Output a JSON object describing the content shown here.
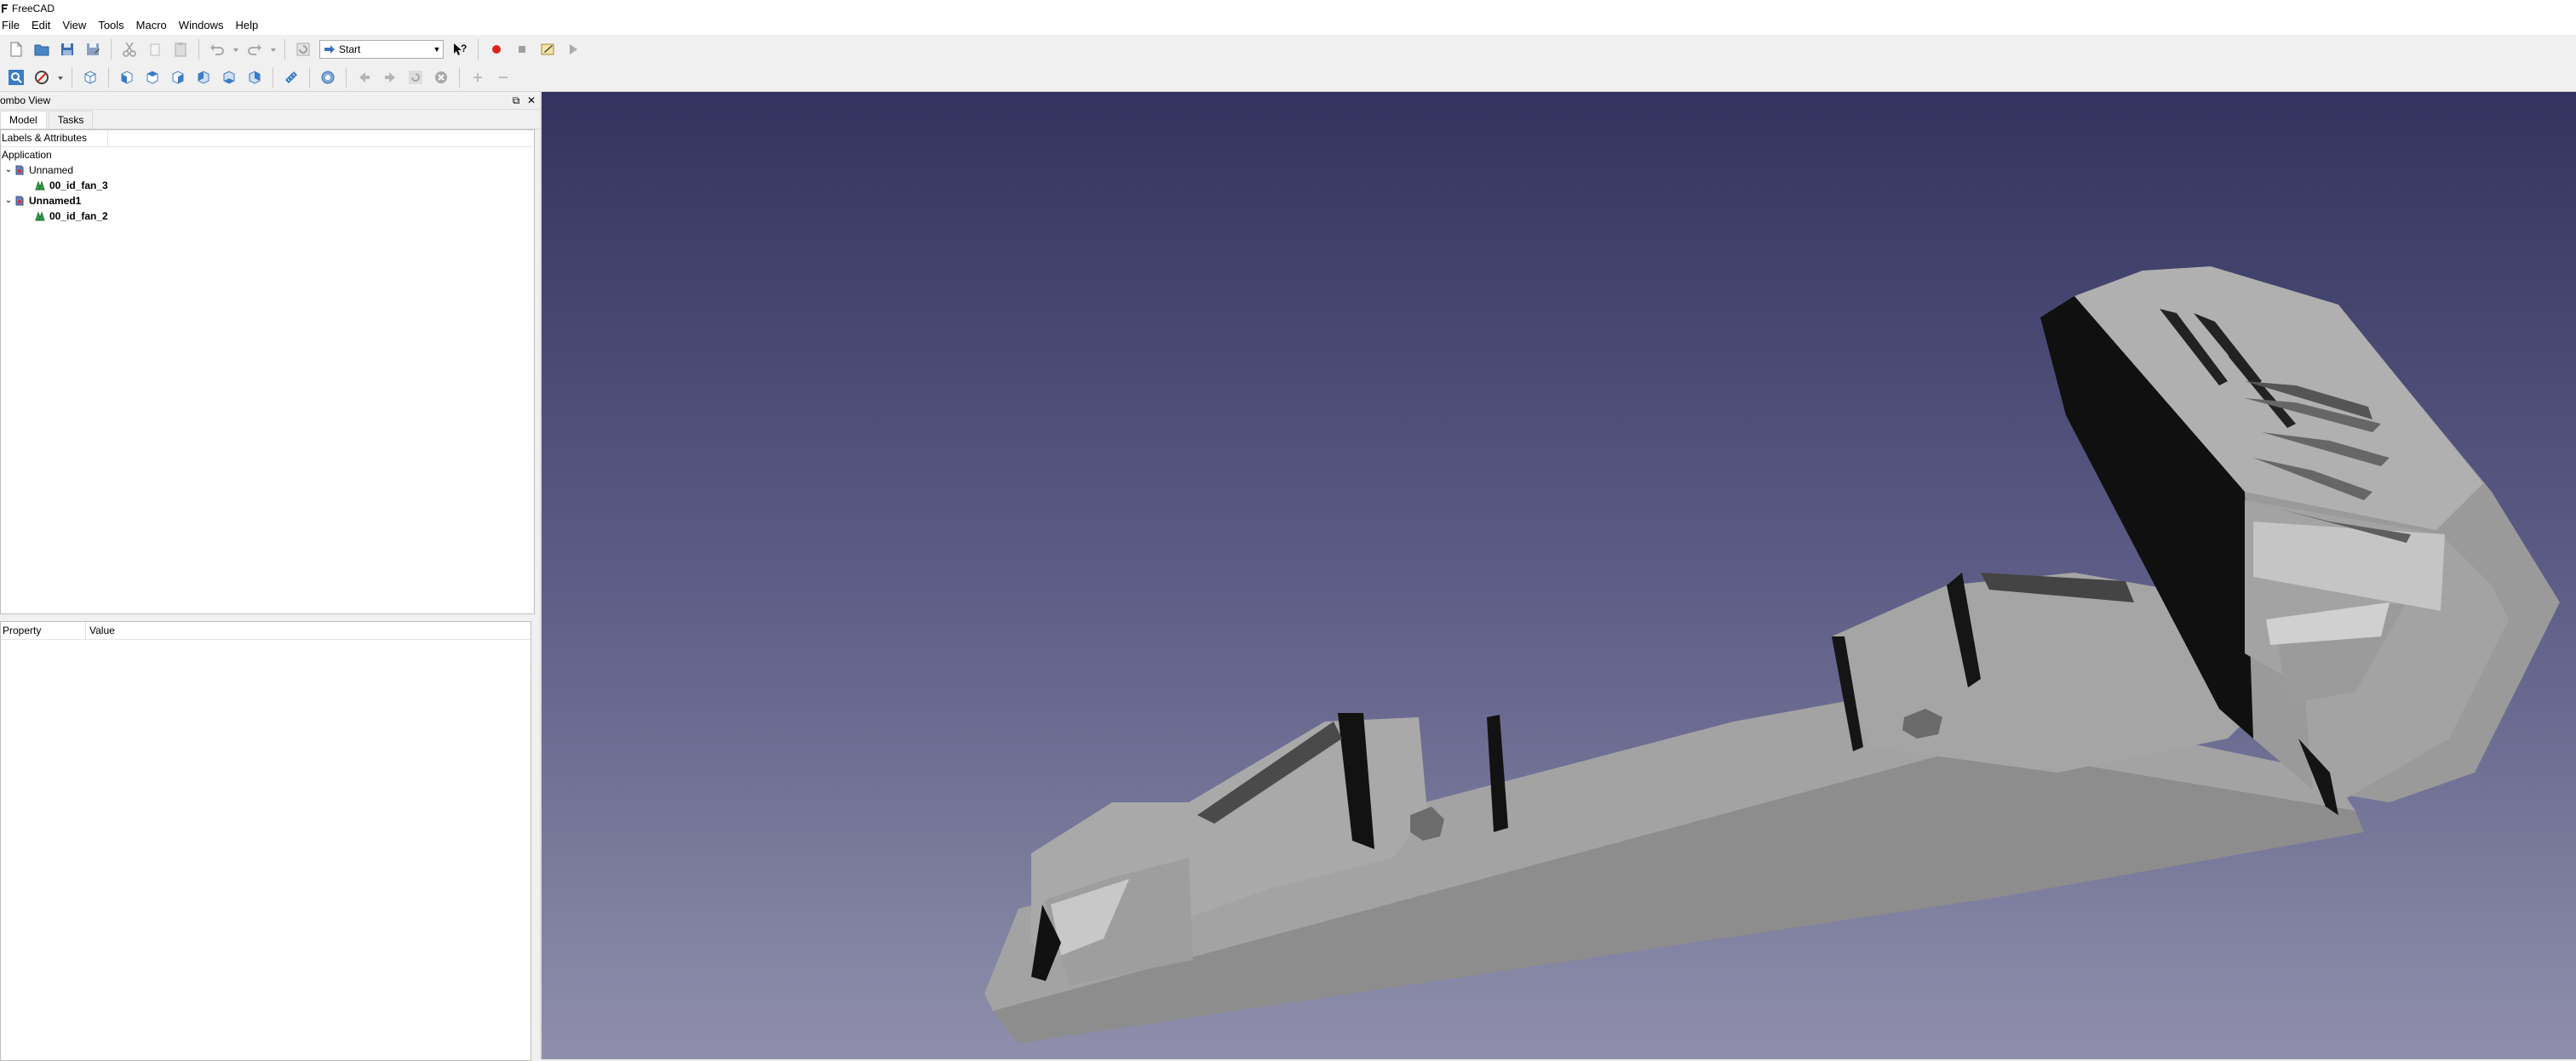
{
  "window": {
    "title": "FreeCAD"
  },
  "menu": [
    "File",
    "Edit",
    "View",
    "Tools",
    "Macro",
    "Windows",
    "Help"
  ],
  "toolbar": {
    "workbench": "Start",
    "icons": [
      "new-icon",
      "open-icon",
      "save-icon",
      "save-as-icon",
      "cut-icon",
      "copy-icon",
      "paste-icon",
      "undo-icon",
      "redo-icon",
      "refresh-icon",
      "whats-this-icon",
      "macro-record-icon",
      "macro-stop-icon",
      "macro-edit-icon",
      "macro-run-icon"
    ]
  },
  "view_toolbar": {
    "icons": [
      "fit-all-icon",
      "draw-style-icon",
      "isometric-view-icon",
      "front-view-icon",
      "top-view-icon",
      "right-view-icon",
      "rear-view-icon",
      "bottom-view-icon",
      "left-view-icon",
      "measure-icon",
      "web-icon",
      "back-icon",
      "forward-icon",
      "refresh-page-icon",
      "stop-icon",
      "zoom-in-icon",
      "zoom-out-icon"
    ]
  },
  "combo_view": {
    "title": "ombo View",
    "tabs": [
      "Model",
      "Tasks"
    ],
    "tree_header": "Labels & Attributes",
    "root": "Application",
    "documents": [
      {
        "label": "Unnamed",
        "bold": false,
        "children": [
          "00_id_fan_3"
        ]
      },
      {
        "label": "Unnamed1",
        "bold": true,
        "children": [
          "00_id_fan_2"
        ]
      }
    ]
  },
  "property_view": {
    "columns": [
      "Property",
      "Value"
    ]
  },
  "colors": {
    "viewport_top": "#33335f",
    "viewport_bottom": "#8f8fac",
    "part": "#a5a5a5"
  }
}
